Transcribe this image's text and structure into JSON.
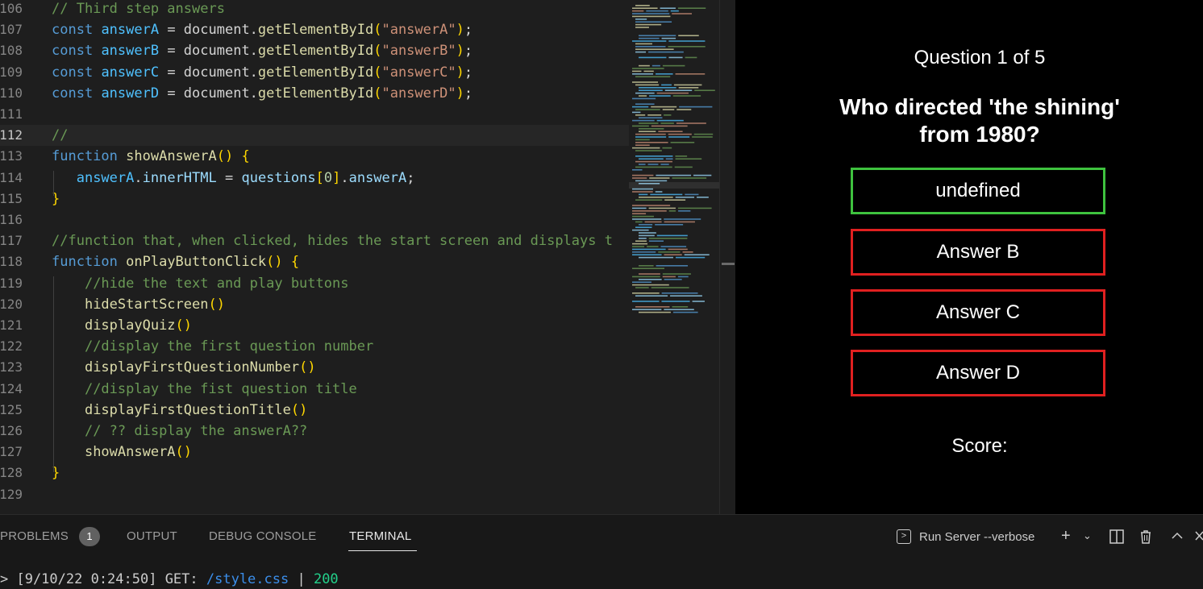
{
  "editor": {
    "lines": [
      {
        "num": "106",
        "text": "// Third step answers"
      },
      {
        "num": "107",
        "text": "const answerA = document.getElementById(\"answerA\");"
      },
      {
        "num": "108",
        "text": "const answerB = document.getElementById(\"answerB\");"
      },
      {
        "num": "109",
        "text": "const answerC = document.getElementById(\"answerC\");"
      },
      {
        "num": "110",
        "text": "const answerD = document.getElementById(\"answerD\");"
      },
      {
        "num": "111",
        "text": ""
      },
      {
        "num": "112",
        "text": "//"
      },
      {
        "num": "113",
        "text": "function showAnswerA() {"
      },
      {
        "num": "114",
        "text": "   answerA.innerHTML = questions[0].answerA;"
      },
      {
        "num": "115",
        "text": "}"
      },
      {
        "num": "116",
        "text": ""
      },
      {
        "num": "117",
        "text": "//function that, when clicked, hides the start screen and displays t"
      },
      {
        "num": "118",
        "text": "function onPlayButtonClick() {"
      },
      {
        "num": "119",
        "text": "    //hide the text and play buttons"
      },
      {
        "num": "120",
        "text": "    hideStartScreen()"
      },
      {
        "num": "121",
        "text": "    displayQuiz()"
      },
      {
        "num": "122",
        "text": "    //display the first question number"
      },
      {
        "num": "123",
        "text": "    displayFirstQuestionNumber()"
      },
      {
        "num": "124",
        "text": "    //display the fist question title"
      },
      {
        "num": "125",
        "text": "    displayFirstQuestionTitle()"
      },
      {
        "num": "126",
        "text": "    // ?? display the answerA??"
      },
      {
        "num": "127",
        "text": "    showAnswerA()"
      },
      {
        "num": "128",
        "text": "}"
      },
      {
        "num": "129",
        "text": ""
      }
    ]
  },
  "quiz": {
    "question_number": "Question 1 of 5",
    "question_title": "Who directed 'the shining' from 1980?",
    "answers": [
      "undefined",
      "Answer B",
      "Answer C",
      "Answer D"
    ],
    "score_label": "Score:"
  },
  "panel": {
    "tabs": [
      "PROBLEMS",
      "OUTPUT",
      "DEBUG CONSOLE",
      "TERMINAL"
    ],
    "problems_count": "1",
    "run_server_label": "Run Server --verbose",
    "terminal": {
      "prefix": "> [9/10/22 0:24:50] GET: ",
      "path": "/style.css",
      "separator": " | ",
      "status": "200"
    },
    "icons": [
      "terminal-icon",
      "plus-icon",
      "chevron-down-icon",
      "split-icon",
      "trash-icon",
      "chevron-up-icon",
      "close-icon"
    ]
  },
  "colors": {
    "correct_border": "#3ec23e",
    "wrong_border": "#e02020",
    "keyword": "#569cd6",
    "function": "#dcdcaa",
    "string": "#ce9178",
    "comment": "#6a9955"
  }
}
